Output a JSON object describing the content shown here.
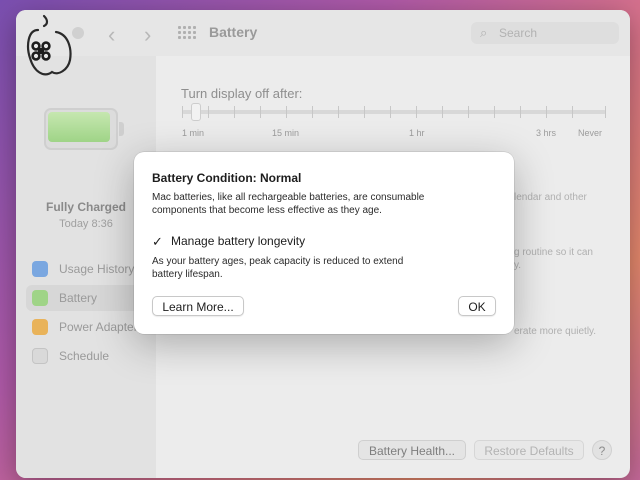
{
  "window": {
    "title": "Battery"
  },
  "search": {
    "placeholder": "Search",
    "icon": "search-icon"
  },
  "sidebar": {
    "status": "Fully Charged",
    "time": "Today 8:36",
    "items": [
      {
        "label": "Usage History",
        "icon": "chart-icon",
        "color": "#7aa7e0"
      },
      {
        "label": "Battery",
        "icon": "battery-icon",
        "color": "#9fd487"
      },
      {
        "label": "Power Adapter",
        "icon": "bolt-icon",
        "color": "#e9b35a"
      },
      {
        "label": "Schedule",
        "icon": "calendar-icon",
        "color": "#d9d9d9"
      }
    ]
  },
  "main": {
    "slider_label": "Turn display off after:",
    "display_off_value": "1 min",
    "ticks": [
      "1 min",
      "15 min",
      "1 hr",
      "3 hrs",
      "Never"
    ],
    "behind_texts": [
      "lendar and other",
      "g routine so it can",
      "y.",
      "erate more quietly."
    ]
  },
  "buttons": {
    "battery_health": "Battery Health...",
    "restore_defaults": "Restore Defaults",
    "help": "?"
  },
  "dialog": {
    "title": "Battery Condition: Normal",
    "body_line1": "Mac batteries, like all rechargeable batteries, are consumable",
    "body_line2": "components that become less effective as they age.",
    "checkbox_label": "Manage battery longevity",
    "checkbox_checked": true,
    "note_line1": "As your battery ages, peak capacity is reduced to extend",
    "note_line2": "battery lifespan.",
    "learn_more": "Learn More...",
    "ok": "OK"
  },
  "colors": {
    "accent_green": "#9fd487",
    "dialog_bg": "#ffffff",
    "window_bg": "#ececec"
  }
}
